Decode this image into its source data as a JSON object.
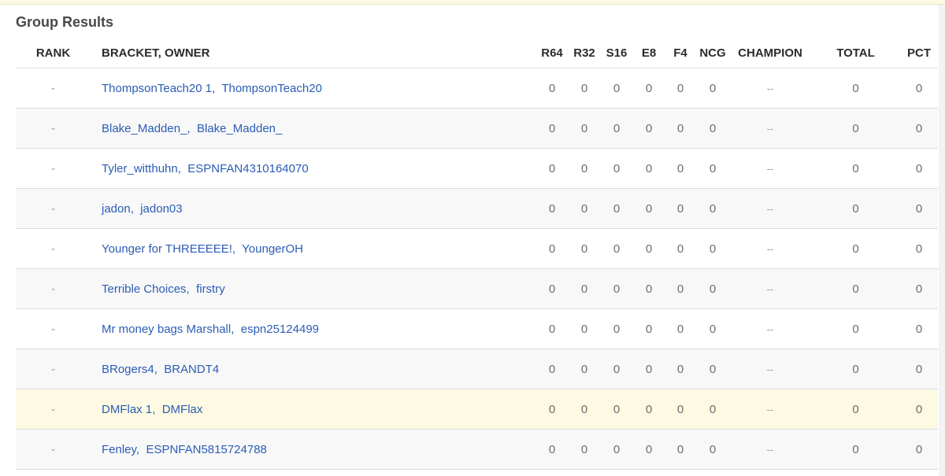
{
  "section": {
    "title": "Group Results"
  },
  "columns": {
    "rank": "RANK",
    "bracket_owner": "BRACKET, OWNER",
    "r64": "R64",
    "r32": "R32",
    "s16": "S16",
    "e8": "E8",
    "f4": "F4",
    "ncg": "NCG",
    "champion": "CHAMPION",
    "total": "TOTAL",
    "pct": "PCT"
  },
  "rows": [
    {
      "rank": "-",
      "bracket": "ThompsonTeach20 1",
      "owner": "ThompsonTeach20",
      "r64": "0",
      "r32": "0",
      "s16": "0",
      "e8": "0",
      "f4": "0",
      "ncg": "0",
      "champion": "--",
      "total": "0",
      "pct": "0"
    },
    {
      "rank": "-",
      "bracket": "Blake_Madden_",
      "owner": "Blake_Madden_",
      "r64": "0",
      "r32": "0",
      "s16": "0",
      "e8": "0",
      "f4": "0",
      "ncg": "0",
      "champion": "--",
      "total": "0",
      "pct": "0"
    },
    {
      "rank": "-",
      "bracket": "Tyler_witthuhn",
      "owner": "ESPNFAN4310164070",
      "r64": "0",
      "r32": "0",
      "s16": "0",
      "e8": "0",
      "f4": "0",
      "ncg": "0",
      "champion": "--",
      "total": "0",
      "pct": "0"
    },
    {
      "rank": "-",
      "bracket": "jadon",
      "owner": "jadon03",
      "r64": "0",
      "r32": "0",
      "s16": "0",
      "e8": "0",
      "f4": "0",
      "ncg": "0",
      "champion": "--",
      "total": "0",
      "pct": "0"
    },
    {
      "rank": "-",
      "bracket": "Younger for THREEEEE!",
      "owner": "YoungerOH",
      "r64": "0",
      "r32": "0",
      "s16": "0",
      "e8": "0",
      "f4": "0",
      "ncg": "0",
      "champion": "--",
      "total": "0",
      "pct": "0"
    },
    {
      "rank": "-",
      "bracket": "Terrible Choices",
      "owner": "firstry",
      "r64": "0",
      "r32": "0",
      "s16": "0",
      "e8": "0",
      "f4": "0",
      "ncg": "0",
      "champion": "--",
      "total": "0",
      "pct": "0"
    },
    {
      "rank": "-",
      "bracket": "Mr money bags Marshall",
      "owner": "espn25124499",
      "r64": "0",
      "r32": "0",
      "s16": "0",
      "e8": "0",
      "f4": "0",
      "ncg": "0",
      "champion": "--",
      "total": "0",
      "pct": "0"
    },
    {
      "rank": "-",
      "bracket": "BRogers4",
      "owner": "BRANDT4",
      "r64": "0",
      "r32": "0",
      "s16": "0",
      "e8": "0",
      "f4": "0",
      "ncg": "0",
      "champion": "--",
      "total": "0",
      "pct": "0"
    },
    {
      "rank": "-",
      "bracket": "DMFlax 1",
      "owner": "DMFlax",
      "r64": "0",
      "r32": "0",
      "s16": "0",
      "e8": "0",
      "f4": "0",
      "ncg": "0",
      "champion": "--",
      "total": "0",
      "pct": "0"
    },
    {
      "rank": "-",
      "bracket": "Fenley",
      "owner": "ESPNFAN5815724788",
      "r64": "0",
      "r32": "0",
      "s16": "0",
      "e8": "0",
      "f4": "0",
      "ncg": "0",
      "champion": "--",
      "total": "0",
      "pct": "0"
    }
  ],
  "colors": {
    "link": "#2b5cb5",
    "highlight_row": "#fdf9e2",
    "alt_row": "#f8f8f8"
  }
}
